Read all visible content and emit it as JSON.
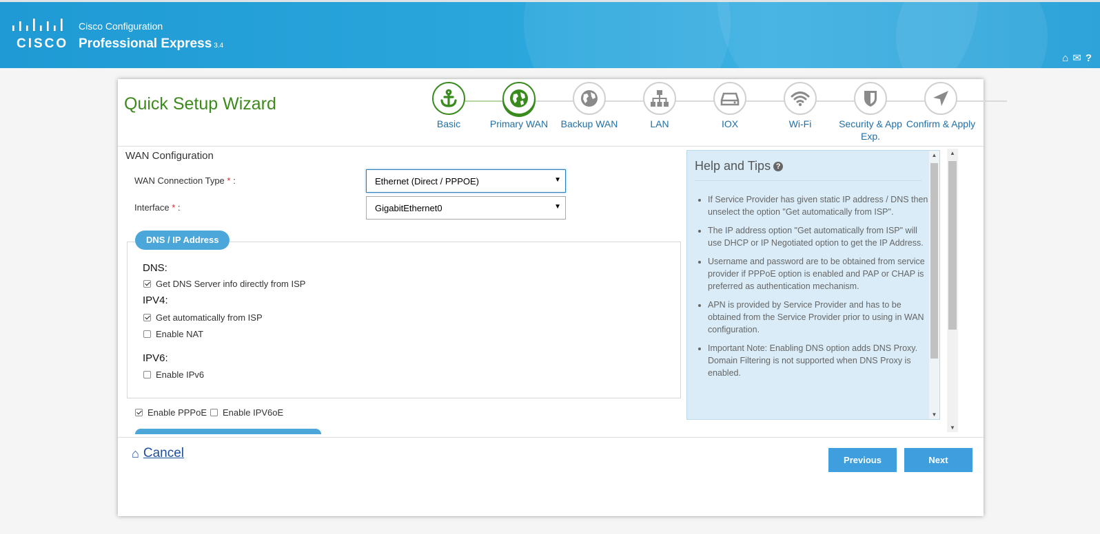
{
  "header": {
    "brand": "CISCO",
    "product_line1": "Cisco Configuration",
    "product_line2": "Professional Express",
    "version": "3.4",
    "icons": [
      "home-icon",
      "mail-icon",
      "help-icon"
    ]
  },
  "wizard": {
    "title": "Quick Setup Wizard",
    "steps": [
      {
        "label": "Basic",
        "icon": "anchor-icon",
        "state": "done"
      },
      {
        "label": "Primary WAN",
        "icon": "globe-icon",
        "state": "active"
      },
      {
        "label": "Backup WAN",
        "icon": "globe-icon",
        "state": "pending"
      },
      {
        "label": "LAN",
        "icon": "network-icon",
        "state": "pending"
      },
      {
        "label": "IOX",
        "icon": "server-icon",
        "state": "pending"
      },
      {
        "label": "Wi-Fi",
        "icon": "wifi-icon",
        "state": "pending"
      },
      {
        "label": "Security & App Exp.",
        "icon": "shield-icon",
        "state": "pending"
      },
      {
        "label": "Confirm & Apply",
        "icon": "send-icon",
        "state": "pending"
      }
    ]
  },
  "form": {
    "section_title": "WAN Configuration",
    "wan_type_label": "WAN Connection Type",
    "wan_type_value": "Ethernet (Direct / PPPOE)",
    "interface_label": "Interface",
    "interface_value": "GigabitEthernet0",
    "required_mark": "*",
    "label_suffix": ":",
    "dns_panel_title": "DNS / IP Address",
    "dns_heading": "DNS:",
    "dns_option": {
      "label": "Get DNS Server info directly from ISP",
      "checked": true
    },
    "ipv4_heading": "IPV4:",
    "ipv4_auto": {
      "label": "Get automatically from ISP",
      "checked": true
    },
    "enable_nat": {
      "label": "Enable NAT",
      "checked": false
    },
    "ipv6_heading": "IPV6:",
    "enable_ipv6": {
      "label": "Enable IPv6",
      "checked": false
    },
    "enable_pppoe": {
      "label": "Enable PPPoE",
      "checked": true
    },
    "enable_ipv6oe": {
      "label": "Enable IPV6oE",
      "checked": false
    }
  },
  "help": {
    "title": "Help and Tips",
    "tips": [
      "If Service Provider has given static IP address / DNS then unselect the option \"Get automatically from ISP\".",
      "The IP address option \"Get automatically from ISP\" will use DHCP or IP Negotiated option to get the IP Address.",
      "Username and password are to be obtained from service provider if PPPoE option is enabled and PAP or CHAP is preferred as authentication mechanism.",
      "APN is provided by Service Provider and has to be obtained from the Service Provider prior to using in WAN configuration.",
      "Important Note: Enabling DNS option adds DNS Proxy. Domain Filtering is not supported when DNS Proxy is enabled."
    ]
  },
  "footer": {
    "cancel_label": "Cancel",
    "previous_label": "Previous",
    "next_label": "Next"
  },
  "colors": {
    "header_blue": "#2aa6dc",
    "title_green": "#3c8a1c",
    "step_done": "#3a8b1e",
    "link_blue": "#1f6fa7",
    "button_blue": "#3e9ede",
    "help_bg": "#d9ecf7"
  }
}
